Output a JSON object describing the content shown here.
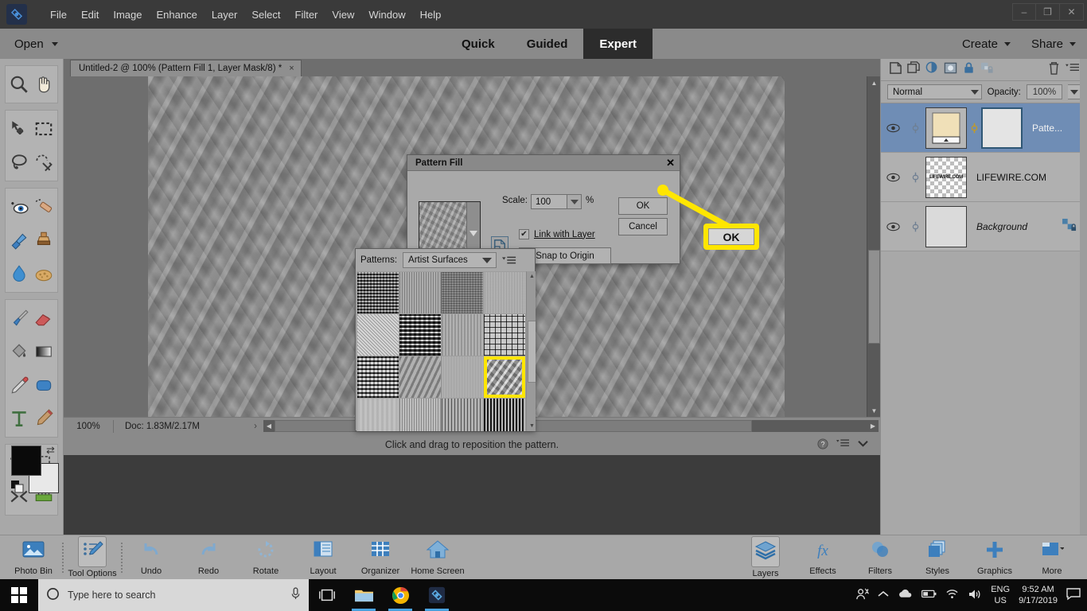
{
  "titlebar": {
    "logo_icon": "photoshop-elements-logo",
    "menus": [
      "File",
      "Edit",
      "Image",
      "Enhance",
      "Layer",
      "Select",
      "Filter",
      "View",
      "Window",
      "Help"
    ],
    "minimize": "–",
    "restore": "❐",
    "close": "✕"
  },
  "modebar": {
    "open_label": "Open",
    "modes": [
      {
        "label": "Quick",
        "active": false
      },
      {
        "label": "Guided",
        "active": false
      },
      {
        "label": "Expert",
        "active": true
      }
    ],
    "create_label": "Create",
    "share_label": "Share"
  },
  "document_tab": {
    "title": "Untitled-2 @ 100% (Pattern Fill 1, Layer Mask/8) *",
    "close": "×"
  },
  "toolbar": {
    "groups": [
      [
        "zoom-tool",
        "hand-tool"
      ],
      [
        "move-tool",
        "rectangular-marquee-tool",
        "lasso-tool",
        "quick-selection-tool"
      ],
      [
        "red-eye-removal-tool",
        "spot-healing-brush-tool",
        "smart-brush-tool",
        "clone-stamp-tool",
        "blur-tool",
        "sponge-tool"
      ],
      [
        "brush-tool",
        "eraser-tool",
        "paint-bucket-tool",
        "gradient-tool",
        "color-picker-tool",
        "shape-tool",
        "type-tool",
        "pencil-tool"
      ],
      [
        "crop-tool",
        "recompose-tool",
        "content-aware-move-tool",
        "straighten-tool"
      ]
    ],
    "foreground_color": "#0a0a0a",
    "background_color": "#e8e8e8",
    "swap_icon": "swap-colors-icon"
  },
  "statusbar": {
    "zoom": "100%",
    "doc_info": "Doc: 1.83M/2.17M",
    "expand_arrow": "›"
  },
  "hint": {
    "text": "Click and drag to reposition the pattern.",
    "icons": [
      "help-icon",
      "panel-menu-icon",
      "chevron-down-icon"
    ]
  },
  "dialog": {
    "title": "Pattern Fill",
    "close": "✕",
    "scale_label": "Scale:",
    "scale_value": "100",
    "percent": "%",
    "link_with_layer_label": "Link with Layer",
    "link_checked": true,
    "check_glyph": "✔",
    "snap_to_origin_label": "Snap to Origin",
    "origin_icon": "origin-toggle-icon",
    "ok_label": "OK",
    "cancel_label": "Cancel"
  },
  "patterns_popup": {
    "label": "Patterns:",
    "preset_value": "Artist Surfaces",
    "menu_icon": "panel-menu-icon",
    "selected_index": 11,
    "cells": [
      {
        "name": "burlap-dark",
        "css": "repeating-linear-gradient(0deg, rgba(0,0,0,.55) 0 2px, rgba(255,255,255,.35) 2px 4px), repeating-linear-gradient(90deg, rgba(0,0,0,.5) 0 2px, rgba(255,255,255,.3) 2px 4px)",
        "base": "#6a6a6a"
      },
      {
        "name": "canvas-soft",
        "css": "repeating-linear-gradient(90deg, rgba(0,0,0,.18) 0 1px, rgba(255,255,255,.18) 1px 3px)",
        "base": "#9a9a9a"
      },
      {
        "name": "stucco-noise",
        "css": "repeating-linear-gradient(90deg, rgba(0,0,0,.6) 0 1px, rgba(255,255,255,.45) 1px 2px), repeating-linear-gradient(0deg, rgba(0,0,0,.35) 0 1px, rgba(255,255,255,.2) 1px 3px)",
        "base": "#7d7d7d"
      },
      {
        "name": "fine-grain-light",
        "css": "repeating-linear-gradient(90deg, rgba(0,0,0,.22) 0 1px, rgba(255,255,255,.3) 1px 2px)",
        "base": "#b4b4b4"
      },
      {
        "name": "speckle-light",
        "css": "repeating-linear-gradient(45deg, rgba(0,0,0,.2) 0 1px, rgba(255,255,255,.35) 1px 3px)",
        "base": "#c2c2c2"
      },
      {
        "name": "mosaic-dark",
        "css": "repeating-linear-gradient(0deg, rgba(0,0,0,.7) 0 3px, rgba(255,255,255,.5) 3px 5px), repeating-linear-gradient(90deg, rgba(0,0,0,.6) 0 3px, rgba(255,255,255,.4) 3px 6px)",
        "base": "#7b7b7b"
      },
      {
        "name": "paper-plain",
        "css": "repeating-linear-gradient(90deg, rgba(0,0,0,.1) 0 2px, rgba(255,255,255,.14) 2px 4px)",
        "base": "#a6a6a6"
      },
      {
        "name": "woven-crosshatch",
        "css": "repeating-linear-gradient(0deg, rgba(0,0,0,.75) 0 1px, transparent 1px 7px), repeating-linear-gradient(90deg, rgba(0,0,0,.75) 0 1px, transparent 1px 7px)",
        "base": "#c8c8c8"
      },
      {
        "name": "weave-dark",
        "css": "repeating-linear-gradient(0deg, rgba(0,0,0,.7) 0 2px, rgba(255,255,255,.45) 2px 5px), repeating-linear-gradient(90deg, rgba(0,0,0,.65) 0 2px, rgba(255,255,255,.4) 2px 5px)",
        "base": "#8a8a8a"
      },
      {
        "name": "marble-mid",
        "css": "repeating-linear-gradient(115deg, rgba(0,0,0,.22) 0 3px, rgba(255,255,255,.2) 3px 7px)",
        "base": "#9e9e9e"
      },
      {
        "name": "vertical-fibers",
        "css": "repeating-linear-gradient(90deg, rgba(0,0,0,.14) 0 1px, rgba(255,255,255,.2) 1px 2px)",
        "base": "#b0b0b0"
      },
      {
        "name": "rough-plaster",
        "css": "repeating-linear-gradient(125deg, rgba(255,255,255,.5) 0 3px, rgba(0,0,0,.25) 3px 8px), repeating-linear-gradient(40deg, rgba(0,0,0,.18) 0 4px, rgba(255,255,255,.22) 4px 9px)",
        "base": "#adadad"
      },
      {
        "name": "smooth-light",
        "css": "repeating-linear-gradient(90deg, rgba(0,0,0,.05) 0 3px, rgba(255,255,255,.06) 3px 6px)",
        "base": "#bdbdbd"
      },
      {
        "name": "sandstone",
        "css": "repeating-linear-gradient(90deg, rgba(0,0,0,.2) 0 1px, rgba(255,255,255,.25) 1px 3px)",
        "base": "#a9a9a9"
      },
      {
        "name": "wood-vertical",
        "css": "repeating-linear-gradient(90deg, rgba(0,0,0,.45) 0 1px, rgba(255,255,255,.3) 1px 4px)",
        "base": "#8f8f8f"
      },
      {
        "name": "bark-streaks",
        "css": "repeating-linear-gradient(90deg, rgba(0,0,0,.8) 0 2px, rgba(255,255,255,.5) 2px 4px)",
        "base": "#6f6f6f"
      }
    ]
  },
  "callout": {
    "label": "OK",
    "color": "#ffe600"
  },
  "layers_panel": {
    "tool_icons": [
      "add-layer-icon",
      "duplicate-layer-icon",
      "adjustment-layer-icon",
      "layer-mask-icon",
      "lock-icon",
      "lock-transparency-icon",
      "delete-layer-icon",
      "panel-menu-icon"
    ],
    "blend_mode": "Normal",
    "opacity_label": "Opacity:",
    "opacity_value": "100%",
    "layers": [
      {
        "name": "Patte...",
        "selected": true,
        "has_mask": true,
        "thumb": "pattern-fill-thumbnail",
        "eye_icon": "eye-icon",
        "link_icon": "link-icon",
        "mask_link_icon": "mask-link-icon",
        "italic": false,
        "locked": false
      },
      {
        "name": "LIFEWIRE.COM",
        "selected": false,
        "has_mask": false,
        "thumb": "text-layer-thumbnail",
        "thumb_text": "LIFEWIRE.COM",
        "eye_icon": "eye-icon",
        "link_icon": "link-icon",
        "italic": false,
        "locked": false
      },
      {
        "name": "Background",
        "selected": false,
        "has_mask": false,
        "thumb": "background-layer-thumbnail",
        "eye_icon": "eye-icon",
        "link_icon": "link-icon",
        "italic": true,
        "locked": true,
        "lock_icon": "layer-lock-icon"
      }
    ]
  },
  "app_taskbar": {
    "items": [
      {
        "label": "Photo Bin",
        "icon": "photo-bin-icon",
        "pressed": false
      },
      {
        "label": "Tool Options",
        "icon": "tool-options-icon",
        "pressed": true
      },
      {
        "label": "Undo",
        "icon": "undo-icon",
        "pressed": false
      },
      {
        "label": "Redo",
        "icon": "redo-icon",
        "pressed": false
      },
      {
        "label": "Rotate",
        "icon": "rotate-icon",
        "pressed": false
      },
      {
        "label": "Layout",
        "icon": "layout-icon",
        "pressed": false
      },
      {
        "label": "Organizer",
        "icon": "organizer-icon",
        "pressed": false
      },
      {
        "label": "Home Screen",
        "icon": "home-screen-icon",
        "pressed": false
      }
    ],
    "right_items": [
      {
        "label": "Layers",
        "icon": "layers-icon",
        "pressed": true
      },
      {
        "label": "Effects",
        "icon": "effects-icon",
        "pressed": false
      },
      {
        "label": "Filters",
        "icon": "filters-icon",
        "pressed": false
      },
      {
        "label": "Styles",
        "icon": "styles-icon",
        "pressed": false
      },
      {
        "label": "Graphics",
        "icon": "graphics-icon",
        "pressed": false
      },
      {
        "label": "More",
        "icon": "more-icon",
        "pressed": false
      }
    ]
  },
  "windows_taskbar": {
    "start_icon": "windows-start-icon",
    "search_placeholder": "Type here to search",
    "search_icon": "search-circle-icon",
    "mic_icon": "microphone-icon",
    "pinned": [
      {
        "icon": "task-view-icon",
        "active": false
      },
      {
        "icon": "file-explorer-icon",
        "active": true
      },
      {
        "icon": "chrome-icon",
        "active": true
      },
      {
        "icon": "photoshop-elements-icon",
        "active": true
      }
    ],
    "tray": {
      "people_icon": "people-icon",
      "chevron_icon": "show-hidden-icons-chevron",
      "onedrive_icon": "onedrive-icon",
      "battery_icon": "battery-icon",
      "wifi_icon": "wifi-icon",
      "volume_icon": "volume-icon",
      "language_line1": "ENG",
      "language_line2": "US",
      "time": "9:52 AM",
      "date": "9/17/2019",
      "notification_icon": "notification-icon"
    }
  }
}
